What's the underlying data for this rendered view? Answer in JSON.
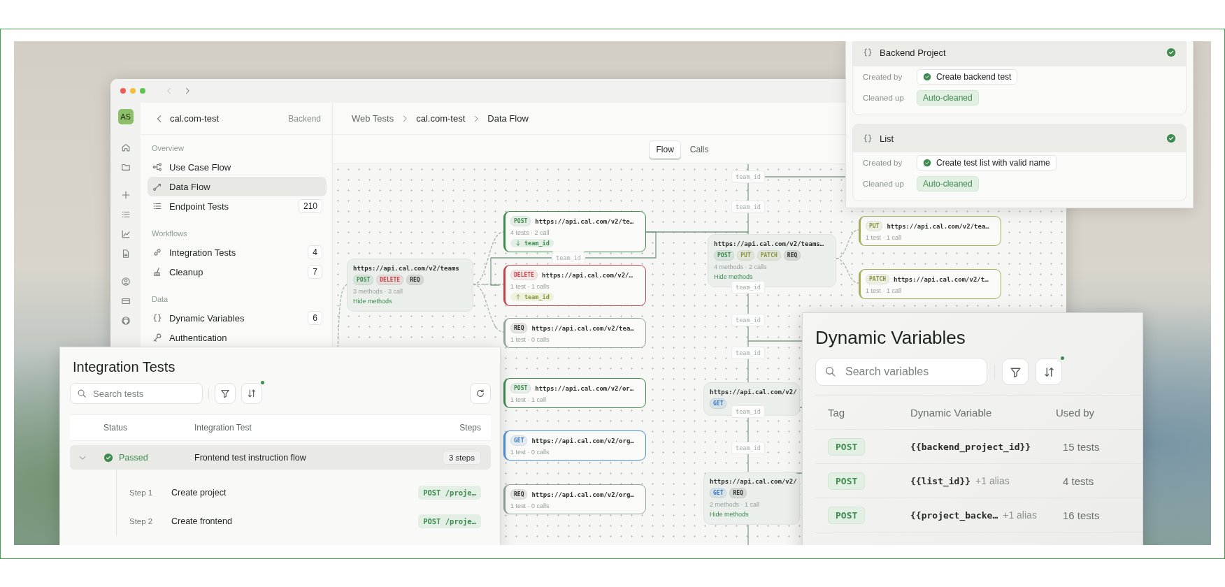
{
  "main_window": {
    "avatar": {
      "initials": "AS"
    },
    "project": {
      "name": "cal.com-test",
      "section": "Backend"
    },
    "nav": [
      {
        "title": "Overview",
        "items": [
          {
            "label": "Use Case Flow",
            "selected": false
          },
          {
            "label": "Data Flow",
            "selected": true
          },
          {
            "label": "Endpoint Tests",
            "selected": false,
            "count": "210"
          }
        ]
      },
      {
        "title": "Workflows",
        "items": [
          {
            "label": "Integration Tests",
            "selected": false,
            "count": "4"
          },
          {
            "label": "Cleanup",
            "selected": false,
            "count": "7"
          }
        ]
      },
      {
        "title": "Data",
        "items": [
          {
            "label": "Dynamic Variables",
            "selected": false,
            "count": "6"
          },
          {
            "label": "Authentication",
            "selected": false
          }
        ]
      }
    ],
    "breadcrumbs": [
      "Web Tests",
      "cal.com-test",
      "Data Flow"
    ],
    "view_tabs": [
      {
        "label": "Flow",
        "selected": true
      },
      {
        "label": "Calls",
        "selected": false
      }
    ],
    "flow": {
      "nodes": [
        {
          "kind": "group",
          "url": "https://api.cal.com/v2/teams",
          "methods": [
            {
              "label": "POST",
              "color": "#3d8b4f"
            },
            {
              "label": "DELETE",
              "color": "#c0444a"
            },
            {
              "label": "REQ",
              "color": "#2f2f2f"
            }
          ],
          "stats": "3 methods · 3 call",
          "toggle": "Hide methods"
        },
        {
          "kind": "endpoint",
          "color": "#3d8b4f",
          "method": {
            "label": "POST",
            "color": "#3d8b4f"
          },
          "url": "https://api.cal.com/v2/te…",
          "stats": "4 tests · 2 call",
          "param": {
            "outgoing": true,
            "name": "team_id"
          }
        },
        {
          "kind": "endpoint",
          "color": "#c0444a",
          "method": {
            "label": "DELETE",
            "color": "#c0444a"
          },
          "url": "https://api.cal.com/v2/…",
          "stats": "1 test · 1 calls",
          "param": {
            "outgoing": false,
            "name": "team_id"
          }
        },
        {
          "kind": "endpoint",
          "color": "#93a597",
          "method": {
            "label": "REQ",
            "color": "#2f2f2f"
          },
          "url": "https://api.cal.com/v2/tea…",
          "stats": "1 test · 0 calls"
        },
        {
          "kind": "endpoint",
          "color": "#3d8b4f",
          "method": {
            "label": "POST",
            "color": "#3d8b4f"
          },
          "url": "https://api.cal.com/v2/or…",
          "stats": "1 test · 1 call"
        },
        {
          "kind": "endpoint",
          "color": "#4a8fd8",
          "method": {
            "label": "GET",
            "color": "#3a78c0"
          },
          "url": "https://api.cal.com/v2/org…",
          "stats": "1 test · 0 calls"
        },
        {
          "kind": "endpoint",
          "color": "#93a597",
          "method": {
            "label": "REQ",
            "color": "#2f2f2f"
          },
          "url": "https://api.cal.com/v2/org…",
          "stats": "1 test · 0 calls"
        },
        {
          "kind": "group",
          "url": "https://api.cal.com/v2/teams…",
          "methods": [
            {
              "label": "POST",
              "color": "#3d8b4f"
            },
            {
              "label": "PUT",
              "color": "#8a9440"
            },
            {
              "label": "PATCH",
              "color": "#8a9440"
            },
            {
              "label": "REQ",
              "color": "#2f2f2f"
            }
          ],
          "stats": "4 methods · 2 calls",
          "toggle": "Hide methods"
        },
        {
          "kind": "endpoint",
          "color": "#a7ae5a",
          "method": {
            "label": "PUT",
            "color": "#8a9440"
          },
          "url": "https://api.cal.com/v2/tea…",
          "stats": "1 test · 1 call"
        },
        {
          "kind": "endpoint",
          "color": "#a7ae5a",
          "method": {
            "label": "PATCH",
            "color": "#8a9440"
          },
          "url": "https://api.cal.com/v2/t…",
          "stats": "1 test · 1 call"
        },
        {
          "kind": "group",
          "url": "https://api.cal.com/v2/",
          "methods": [
            {
              "label": "GET",
              "color": "#3a78c0"
            }
          ]
        },
        {
          "kind": "group",
          "url": "https://api.cal.com/v2/",
          "methods": [
            {
              "label": "GET",
              "color": "#3a78c0"
            },
            {
              "label": "REQ",
              "color": "#2f2f2f"
            }
          ],
          "stats": "2 methods · 1 call",
          "toggle": "Hide methods"
        }
      ],
      "edge_labels": [
        "team_id",
        "team_id",
        "team_id",
        "team_id",
        "team_id",
        "team_id",
        "team_id",
        "team_id"
      ]
    }
  },
  "variables_panel": {
    "cards": [
      {
        "name": "Backend Project",
        "created_by_label": "Created by",
        "created_by": "Create backend test",
        "cleaned_up_label": "Cleaned up",
        "cleaned_up": "Auto-cleaned"
      },
      {
        "name": "List",
        "created_by_label": "Created by",
        "created_by": "Create test list with valid name",
        "cleaned_up_label": "Cleaned up",
        "cleaned_up": "Auto-cleaned"
      }
    ]
  },
  "integration_panel": {
    "title": "Integration Tests",
    "search": {
      "placeholder": "Search tests"
    },
    "columns": [
      "Status",
      "Integration Test",
      "Steps"
    ],
    "tests": [
      {
        "expanded": true,
        "status": "Passed",
        "name": "Frontend test instruction flow",
        "steps": "3 steps",
        "step_rows": [
          {
            "step": "Step 1",
            "name": "Create project",
            "endpoint": "POST /proje…"
          },
          {
            "step": "Step 2",
            "name": "Create frontend",
            "endpoint": "POST /proje…"
          }
        ]
      }
    ]
  },
  "dynamic_variables_panel": {
    "title": "Dynamic Variables",
    "search": {
      "placeholder": "Search variables"
    },
    "columns": [
      "Tag",
      "Dynamic Variable",
      "Used by"
    ],
    "rows": [
      {
        "tag": "POST",
        "variable": "{{backend_project_id}}",
        "used_by": "15 tests"
      },
      {
        "tag": "POST",
        "variable": "{{list_id}}",
        "alias": "+1 alias",
        "used_by": "4 tests"
      },
      {
        "tag": "POST",
        "variable": "{{project_backe…",
        "alias": "+1 alias",
        "used_by": "16 tests"
      }
    ]
  }
}
